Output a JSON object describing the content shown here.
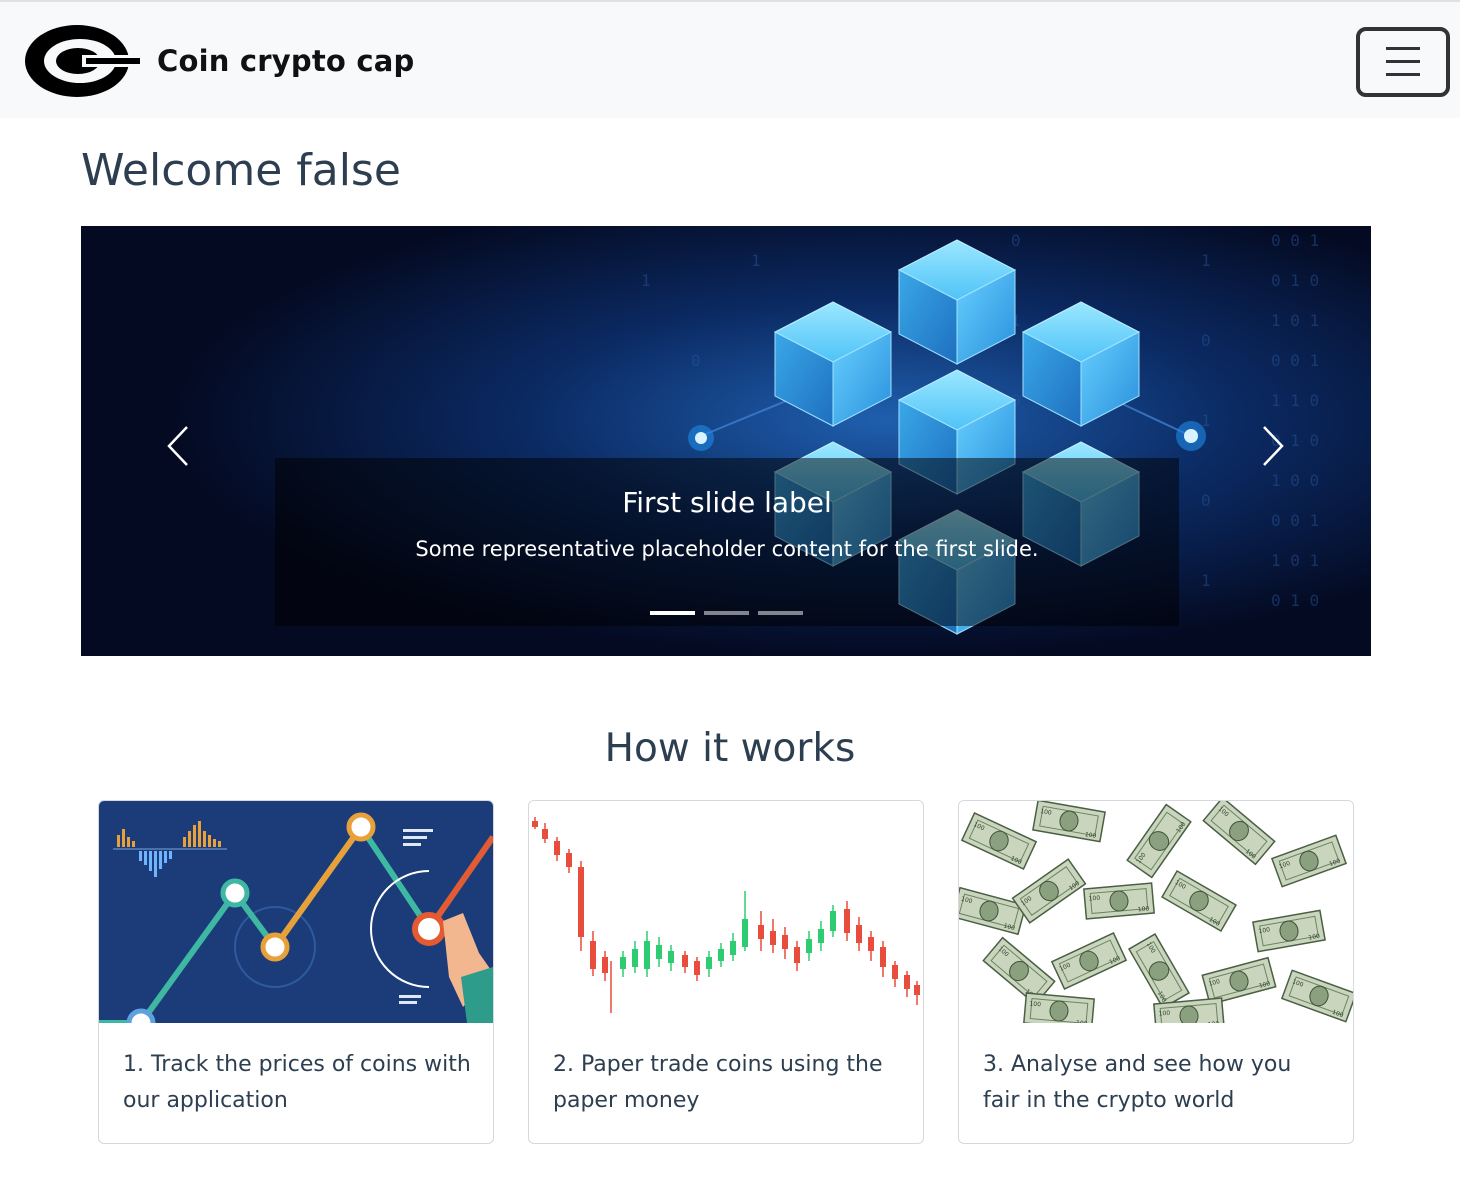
{
  "navbar": {
    "brand_name": "Coin crypto cap",
    "toggler_icon": "hamburger-menu-icon"
  },
  "page": {
    "welcome_title": "Welcome false"
  },
  "carousel": {
    "slide_label": "First slide label",
    "slide_text": "Some representative placeholder content for the first slide.",
    "prev_icon": "chevron-left-icon",
    "next_icon": "chevron-right-icon",
    "indicator_count": 3,
    "active_index": 0
  },
  "how_it_works": {
    "title": "How it works",
    "cards": [
      {
        "text": "1. Track the prices of coins with our application"
      },
      {
        "text": "2. Paper trade coins using the paper money"
      },
      {
        "text": "3. Analyse and see how you fair in the crypto world"
      }
    ]
  },
  "colors": {
    "navbar_bg": "#f8f9fa",
    "heading": "#2c3e50",
    "carousel_bg": "#050d2a",
    "cube_blue": "#4fc3f7"
  }
}
